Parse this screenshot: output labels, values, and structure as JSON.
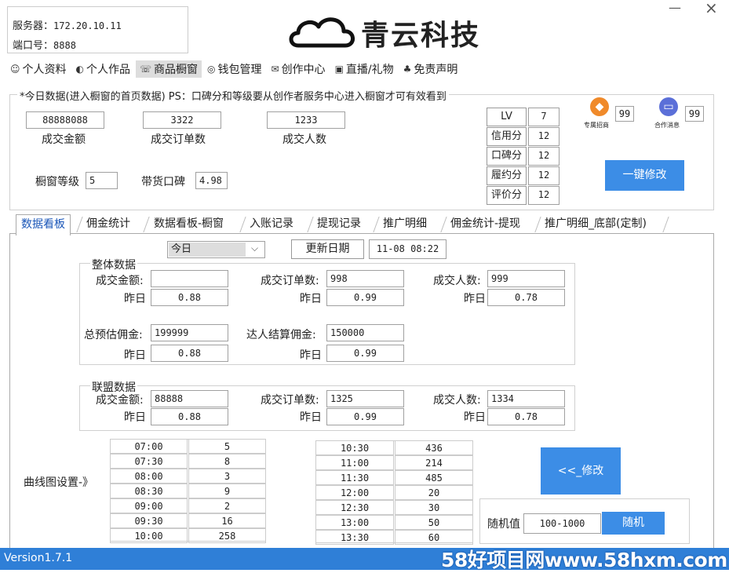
{
  "server": {
    "server_label": "服务器：",
    "server_value": "172.20.10.11",
    "port_label": "端口号：",
    "port_value": "8888"
  },
  "brand": {
    "name": "青云科技"
  },
  "window": {
    "minimize": "—",
    "close": "×"
  },
  "nav": [
    {
      "label": "个人资料",
      "icon": "profile-icon"
    },
    {
      "label": "个人作品",
      "icon": "works-icon"
    },
    {
      "label": "商品橱窗",
      "icon": "shop-icon"
    },
    {
      "label": "钱包管理",
      "icon": "wallet-icon"
    },
    {
      "label": "创作中心",
      "icon": "mail-icon"
    },
    {
      "label": "直播/礼物",
      "icon": "live-icon"
    },
    {
      "label": "免责声明",
      "icon": "disclaimer-icon"
    }
  ],
  "today": {
    "legend": "*今日数据(进入橱窗的首页数据) PS：口碑分和等级要从创作者服务中心进入橱窗才可有效看到",
    "gmv": {
      "value": "88888088",
      "label": "成交金额"
    },
    "orders": {
      "value": "3322",
      "label": "成交订单数"
    },
    "buyers": {
      "value": "1233",
      "label": "成交人数"
    },
    "level_label": "橱窗等级",
    "level_value": "5",
    "reputation_label": "带货口碑",
    "reputation_value": "4.98",
    "scores": [
      {
        "label": "LV",
        "value": "7"
      },
      {
        "label": "信用分",
        "value": "12"
      },
      {
        "label": "口碑分",
        "value": "12"
      },
      {
        "label": "履约分",
        "value": "12"
      },
      {
        "label": "评价分",
        "value": "12"
      }
    ],
    "badge1": {
      "label": "专属招商",
      "count": "99"
    },
    "badge2": {
      "label": "合作消息",
      "count": "99"
    },
    "modify_button": "一键修改"
  },
  "tabs": [
    "数据看板",
    "佣金统计",
    "数据看板-橱窗",
    "入账记录",
    "提现记录",
    "推广明细",
    "佣金统计-提现",
    "推广明细_底部(定制)"
  ],
  "dashboard": {
    "period_select": "今日",
    "update_date_button": "更新日期",
    "update_date_value": "11-08 08:22",
    "overall": {
      "title": "整体数据",
      "gmv_label": "成交金额:",
      "gmv_value": "",
      "orders_label": "成交订单数:",
      "orders_value": "998",
      "buyers_label": "成交人数:",
      "buyers_value": "999",
      "yesterday_label": "昨日",
      "gmv_yday": "0.88",
      "orders_yday": "0.99",
      "buyers_yday": "0.78",
      "est_comm_label": "总预估佣金:",
      "est_comm_value": "199999",
      "settle_comm_label": "达人结算佣金:",
      "settle_comm_value": "150000",
      "est_comm_yday": "0.88",
      "settle_comm_yday": "0.99"
    },
    "alliance": {
      "title": "联盟数据",
      "gmv_label": "成交金额:",
      "gmv_value": "88888",
      "orders_label": "成交订单数:",
      "orders_value": "1325",
      "buyers_label": "成交人数:",
      "buyers_value": "1334",
      "yesterday_label": "昨日",
      "gmv_yday": "0.88",
      "orders_yday": "0.99",
      "buyers_yday": "0.78"
    },
    "curve_label": "曲线图设置-》",
    "curve_table_left": [
      [
        "07:00",
        "5"
      ],
      [
        "07:30",
        "8"
      ],
      [
        "08:00",
        "3"
      ],
      [
        "08:30",
        "9"
      ],
      [
        "09:00",
        "2"
      ],
      [
        "09:30",
        "16"
      ],
      [
        "10:00",
        "258"
      ]
    ],
    "curve_table_right": [
      [
        "10:30",
        "436"
      ],
      [
        "11:00",
        "214"
      ],
      [
        "11:30",
        "485"
      ],
      [
        "12:00",
        "20"
      ],
      [
        "12:30",
        "30"
      ],
      [
        "13:00",
        "50"
      ],
      [
        "13:30",
        "60"
      ]
    ],
    "modify_button": "<<_修改",
    "random_label": "随机值",
    "random_value": "100-1000",
    "random_button": "随机"
  },
  "status": {
    "version": "Version1.7.1",
    "watermark": "58好项目网www.58hxm.com"
  },
  "colors": {
    "accent": "#3c8de6",
    "status_bar": "#2f7fd7",
    "tab_active": "#1a56b8"
  }
}
